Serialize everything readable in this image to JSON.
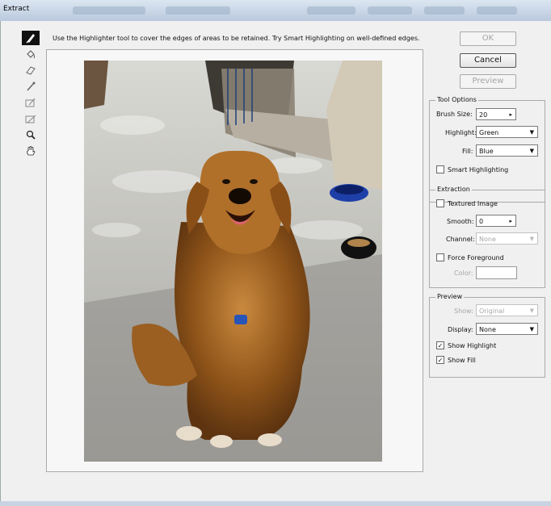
{
  "window": {
    "title": "Extract"
  },
  "hint": "Use the Highlighter tool to cover the edges of areas to be retained. Try Smart Highlighting on well-defined edges.",
  "buttons": {
    "ok": "OK",
    "cancel": "Cancel",
    "preview": "Preview"
  },
  "tool_options": {
    "legend": "Tool Options",
    "brush_size_label": "Brush Size:",
    "brush_size_value": "20",
    "highlight_label": "Highlight:",
    "highlight_value": "Green",
    "fill_label": "Fill:",
    "fill_value": "Blue",
    "smart_highlighting": "Smart Highlighting"
  },
  "extraction": {
    "legend": "Extraction",
    "textured_image": "Textured Image",
    "smooth_label": "Smooth:",
    "smooth_value": "0",
    "channel_label": "Channel:",
    "channel_value": "None",
    "force_foreground": "Force Foreground",
    "color_label": "Color:"
  },
  "preview_group": {
    "legend": "Preview",
    "show_label": "Show:",
    "show_value": "Original",
    "display_label": "Display:",
    "display_value": "None",
    "show_highlight": "Show Highlight",
    "show_fill": "Show Fill"
  },
  "checkboxes": {
    "smart_highlighting": false,
    "textured_image": false,
    "force_foreground": false,
    "show_highlight": true,
    "show_fill": true
  },
  "tools": [
    "edge-highlighter-icon",
    "fill-icon",
    "eraser-icon",
    "eyedropper-icon",
    "cleanup-icon",
    "edge-touchup-icon",
    "zoom-icon",
    "hand-icon"
  ]
}
